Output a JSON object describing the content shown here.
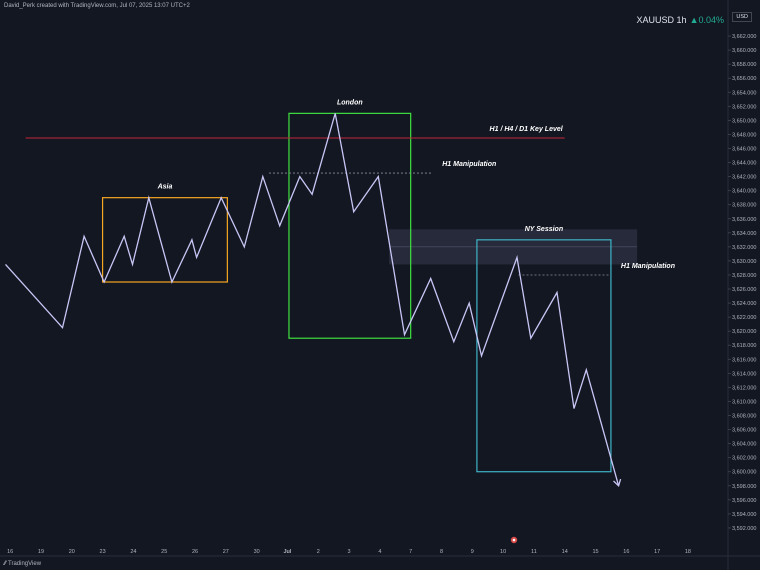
{
  "header": {
    "credit": "David_Perk created with TradingView.com, Jul 07, 2025 13:07 UTC+2",
    "symbol": "XAUUSD 1h",
    "change": "▲0.04%",
    "currency": "USD"
  },
  "footer": {
    "brand": "TradingView"
  },
  "colors": {
    "background": "#131722",
    "line": "#c9c5f5",
    "key_level": "#c0263a",
    "asia_box": "#f5a623",
    "london_box": "#3fe03f",
    "ny_box": "#3fb4c8",
    "accent_up": "#22ab94"
  },
  "chart_data": {
    "type": "line",
    "title": "",
    "xlabel": "",
    "ylabel": "",
    "y_axis_position": "right",
    "ylim": [
      3590,
      3664
    ],
    "y_ticks": [
      3592,
      3594,
      3596,
      3598,
      3600,
      3602,
      3604,
      3606,
      3608,
      3610,
      3612,
      3614,
      3616,
      3618,
      3620,
      3622,
      3624,
      3626,
      3628,
      3630,
      3632,
      3634,
      3636,
      3638,
      3640,
      3642,
      3644,
      3646,
      3648,
      3650,
      3652,
      3654,
      3656,
      3658,
      3660,
      3662
    ],
    "x_ticks": [
      {
        "label": "16",
        "x": 0
      },
      {
        "label": "19",
        "x": 1
      },
      {
        "label": "20",
        "x": 2
      },
      {
        "label": "23",
        "x": 3
      },
      {
        "label": "24",
        "x": 4
      },
      {
        "label": "25",
        "x": 5
      },
      {
        "label": "26",
        "x": 6
      },
      {
        "label": "27",
        "x": 7
      },
      {
        "label": "30",
        "x": 8
      },
      {
        "label": "Jul",
        "x": 9
      },
      {
        "label": "2",
        "x": 10
      },
      {
        "label": "3",
        "x": 11
      },
      {
        "label": "4",
        "x": 12
      },
      {
        "label": "7",
        "x": 13
      },
      {
        "label": "8",
        "x": 14
      },
      {
        "label": "9",
        "x": 15
      },
      {
        "label": "10",
        "x": 16
      },
      {
        "label": "11",
        "x": 17
      },
      {
        "label": "14",
        "x": 18
      },
      {
        "label": "15",
        "x": 19
      },
      {
        "label": "16",
        "x": 20
      },
      {
        "label": "17",
        "x": 21
      },
      {
        "label": "18",
        "x": 22
      }
    ],
    "xlim": [
      -0.2,
      23.3
    ],
    "series": [
      {
        "values": [
          [
            -0.15,
            3629.5
          ],
          [
            1.7,
            3620.5
          ],
          [
            2.4,
            3633.5
          ],
          [
            3.05,
            3627.0
          ],
          [
            3.7,
            3633.5
          ],
          [
            3.97,
            3629.5
          ],
          [
            4.5,
            3639.0
          ],
          [
            5.25,
            3627.0
          ],
          [
            5.9,
            3633.0
          ],
          [
            6.05,
            3630.5
          ],
          [
            6.85,
            3639.0
          ],
          [
            7.6,
            3632.0
          ],
          [
            8.2,
            3642.0
          ],
          [
            8.75,
            3635.0
          ],
          [
            9.4,
            3642.0
          ],
          [
            9.8,
            3639.5
          ],
          [
            10.55,
            3651.0
          ],
          [
            11.15,
            3637.0
          ],
          [
            11.95,
            3642.0
          ],
          [
            12.8,
            3619.5
          ],
          [
            13.65,
            3627.5
          ],
          [
            14.4,
            3618.5
          ],
          [
            14.9,
            3624.0
          ],
          [
            15.3,
            3616.5
          ],
          [
            16.45,
            3630.5
          ],
          [
            16.9,
            3619.0
          ],
          [
            17.75,
            3625.5
          ],
          [
            18.3,
            3609.0
          ],
          [
            18.7,
            3614.5
          ],
          [
            19.75,
            3598.0
          ]
        ]
      }
    ],
    "key_level": {
      "y": 3647.5,
      "x_from": 0.5,
      "x_to": 18.0,
      "label": "H1 / H4 / D1 Key  Level"
    },
    "boxes": [
      {
        "label": "Asia",
        "x0": 3.0,
        "x1": 7.05,
        "y0": 3627.0,
        "y1": 3639.0
      },
      {
        "label": "London",
        "x0": 9.05,
        "x1": 13.0,
        "y0": 3619.0,
        "y1": 3651.0
      },
      {
        "label": "NY Session",
        "x0": 15.15,
        "x1": 19.5,
        "y0": 3600.0,
        "y1": 3633.0
      }
    ],
    "shaded_zone": {
      "x0": 12.3,
      "x1": 20.35,
      "y0": 3629.5,
      "y1": 3634.5
    },
    "manipulation_lines": [
      {
        "label": "H1  Manipulation",
        "y": 3642.5,
        "x_from": 8.4,
        "x_to": 13.7
      },
      {
        "label": "H1  Manipulation",
        "y": 3628.0,
        "x_from": 16.5,
        "x_to": 19.5
      }
    ]
  }
}
